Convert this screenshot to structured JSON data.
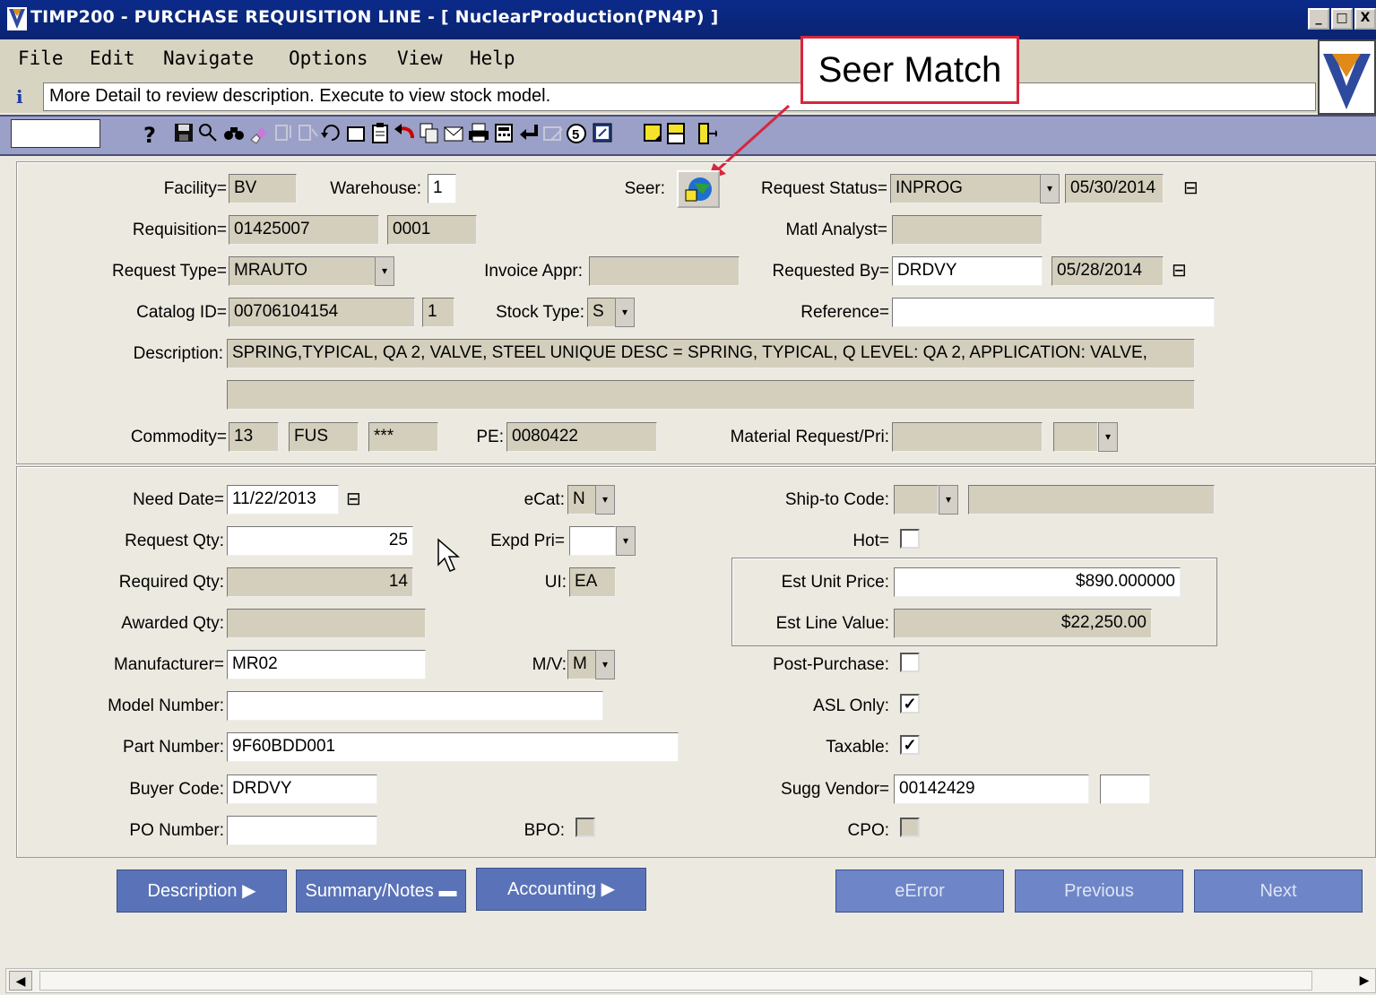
{
  "window": {
    "title": "TIMP200 - PURCHASE REQUISITION LINE - [ NuclearProduction(PN4P) ]",
    "controls": [
      "_",
      "□",
      "X"
    ]
  },
  "menu": [
    "File",
    "Edit",
    "Navigate",
    "Options",
    "View",
    "Help"
  ],
  "info_message": "More Detail to review description. Execute to view stock model.",
  "callout": "Seer Match",
  "toolbar_icons": [
    "help-icon",
    "save-icon",
    "search-icon",
    "binoculars-icon",
    "eraser-icon",
    "insert-row-icon",
    "delete-row-icon",
    "refresh-icon",
    "new-icon",
    "clipboard-icon",
    "undo-icon",
    "copy-icon",
    "email-icon",
    "print-icon",
    "calculator-icon",
    "enter-icon",
    "disabled-icon",
    "five-icon",
    "export-icon",
    "note-icon",
    "report-icon",
    "exit-icon"
  ],
  "header": {
    "facility": {
      "label": "Facility=",
      "value": "BV"
    },
    "warehouse": {
      "label": "Warehouse:",
      "value": "1"
    },
    "seer": {
      "label": "Seer:"
    },
    "request_status": {
      "label": "Request Status=",
      "value": "INPROG",
      "date": "05/30/2014"
    },
    "requisition": {
      "label": "Requisition=",
      "value": "01425007",
      "line": "0001"
    },
    "matl_analyst": {
      "label": "Matl Analyst=",
      "value": ""
    },
    "request_type": {
      "label": "Request Type=",
      "value": "MRAUTO"
    },
    "invoice_appr": {
      "label": "Invoice Appr:",
      "value": ""
    },
    "requested_by": {
      "label": "Requested By=",
      "value": "DRDVY",
      "date": "05/28/2014"
    },
    "catalog_id": {
      "label": "Catalog ID=",
      "value": "00706104154",
      "suffix": "1"
    },
    "stock_type": {
      "label": "Stock Type:",
      "value": "S"
    },
    "reference": {
      "label": "Reference=",
      "value": ""
    },
    "description": {
      "label": "Description:",
      "line1": "SPRING,TYPICAL, QA 2, VALVE, STEEL UNIQUE DESC = SPRING, TYPICAL, Q LEVEL: QA 2, APPLICATION: VALVE,",
      "line2": ""
    },
    "commodity": {
      "label": "Commodity=",
      "v1": "13",
      "v2": "FUS",
      "v3": "***"
    },
    "pe": {
      "label": "PE:",
      "value": "0080422"
    },
    "material_request": {
      "label": "Material Request/Pri:",
      "value": "",
      "pri": ""
    }
  },
  "detail": {
    "need_date": {
      "label": "Need Date=",
      "value": "11/22/2013"
    },
    "ecat": {
      "label": "eCat:",
      "value": "N"
    },
    "ship_to": {
      "label": "Ship-to Code:",
      "value": "",
      "desc": ""
    },
    "request_qty": {
      "label": "Request Qty:",
      "value": "25"
    },
    "expd_pri": {
      "label": "Expd Pri=",
      "value": ""
    },
    "hot": {
      "label": "Hot=",
      "checked": false
    },
    "required_qty": {
      "label": "Required Qty:",
      "value": "14"
    },
    "ui": {
      "label": "UI:",
      "value": "EA"
    },
    "est_unit_price": {
      "label": "Est Unit Price:",
      "value": "$890.000000"
    },
    "awarded_qty": {
      "label": "Awarded Qty:",
      "value": ""
    },
    "est_line_value": {
      "label": "Est Line Value:",
      "value": "$22,250.00"
    },
    "manufacturer": {
      "label": "Manufacturer=",
      "value": "MR02"
    },
    "mv": {
      "label": "M/V:",
      "value": "M"
    },
    "post_purchase": {
      "label": "Post-Purchase:",
      "checked": false
    },
    "model_number": {
      "label": "Model Number:",
      "value": ""
    },
    "asl_only": {
      "label": "ASL Only:",
      "checked": true
    },
    "part_number": {
      "label": "Part Number:",
      "value": "9F60BDD001"
    },
    "taxable": {
      "label": "Taxable:",
      "checked": true
    },
    "buyer_code": {
      "label": "Buyer Code:",
      "value": "DRDVY"
    },
    "sugg_vendor": {
      "label": "Sugg Vendor=",
      "value": "00142429",
      "extra": ""
    },
    "po_number": {
      "label": "PO Number:",
      "value": ""
    },
    "bpo": {
      "label": "BPO:",
      "checked": false
    },
    "cpo": {
      "label": "CPO:",
      "checked": false
    }
  },
  "buttons": {
    "description": "Description",
    "summary_notes": "Summary/Notes",
    "accounting": "Accounting",
    "eerror": "eError",
    "previous": "Previous",
    "next": "Next"
  },
  "colors": {
    "title_bar": "#0b2a8a",
    "toolbar": "#9aa0c7",
    "button": "#5a73b8",
    "callout_border": "#d8263d"
  }
}
